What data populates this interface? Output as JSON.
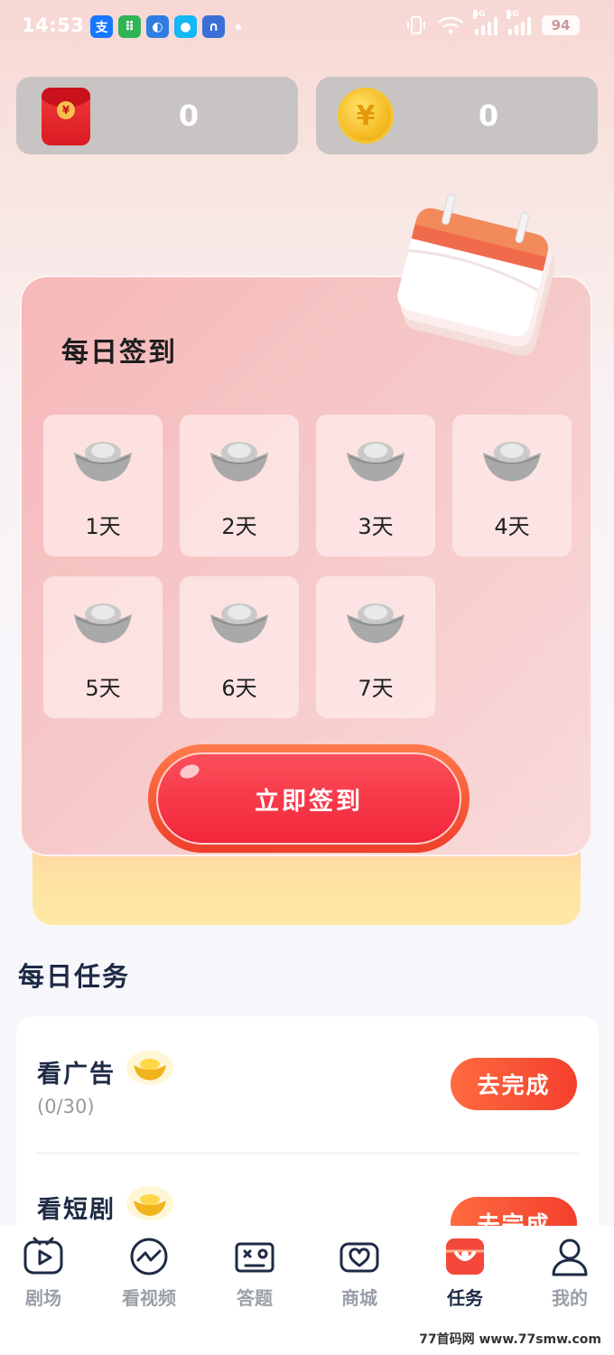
{
  "status_bar": {
    "time": "14:53",
    "battery": "94",
    "apps": [
      {
        "icon": "alipay-icon",
        "glyph": "支",
        "color": "#1677ff"
      },
      {
        "icon": "wechat-mini-icon",
        "glyph": "⠿",
        "color": "#2fb456"
      },
      {
        "icon": "browser-icon",
        "glyph": "◐",
        "color": "#2f7de1"
      },
      {
        "icon": "qq-icon",
        "glyph": "●",
        "color": "#12b7f5"
      },
      {
        "icon": "vpn-icon",
        "glyph": "∩",
        "color": "#3a6fd8"
      }
    ]
  },
  "balances": {
    "red_packet": "0",
    "coin": "0",
    "coin_symbol": "¥",
    "packet_symbol": "¥"
  },
  "checkin": {
    "title": "每日签到",
    "days": [
      "1天",
      "2天",
      "3天",
      "4天",
      "5天",
      "6天",
      "7天"
    ],
    "button": "立即签到"
  },
  "tasks": {
    "title": "每日任务",
    "items": [
      {
        "name": "看广告",
        "progress": "(0/30)",
        "button": "去完成"
      },
      {
        "name": "看短剧",
        "progress": "",
        "button": "去完成"
      }
    ]
  },
  "nav": {
    "items": [
      "剧场",
      "看视频",
      "答题",
      "商城",
      "任务",
      "我的"
    ],
    "active": "任务"
  },
  "watermark": "77首码网  www.77smw.com",
  "colors": {
    "accent_red": "#f2263a",
    "task_orange": "#fe6b3f",
    "nav_text": "#9aa0a8",
    "title_navy": "#1e2a45"
  }
}
